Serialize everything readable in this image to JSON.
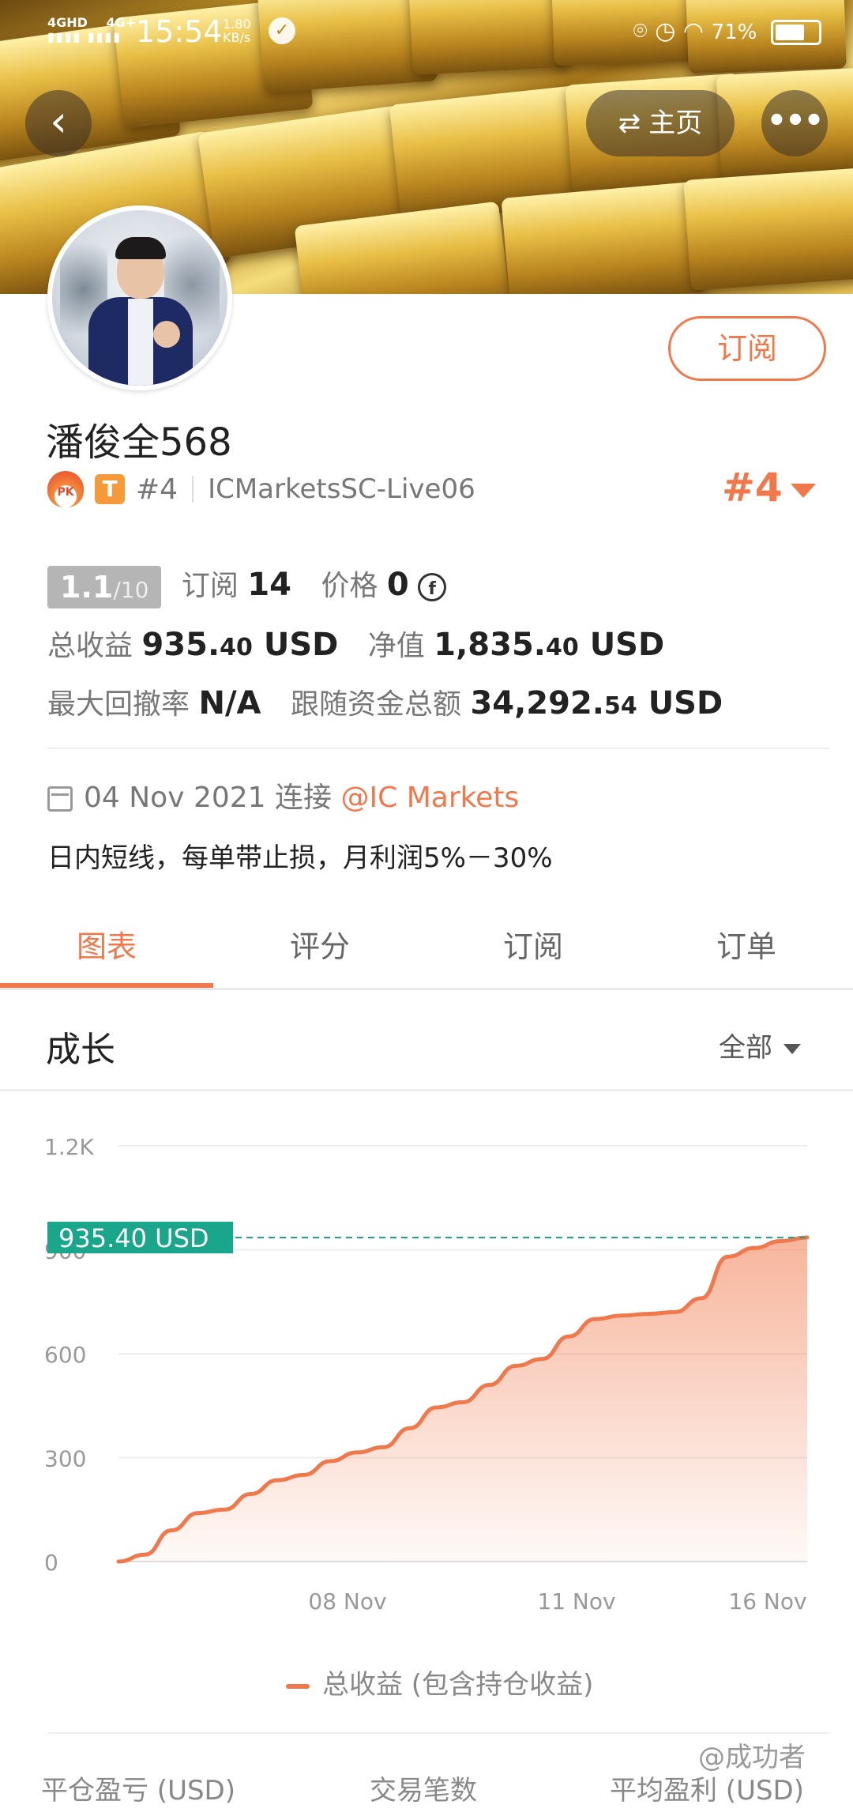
{
  "status_bar": {
    "network_1": "4GHD",
    "network_2": "4G+",
    "time": "15:54",
    "speed_value": "1.80",
    "speed_unit": "KB/s",
    "battery_text": "71%"
  },
  "header": {
    "home_label": "主页"
  },
  "profile": {
    "subscribe_label": "订阅",
    "name": "潘俊全568",
    "pk_badge": "PK",
    "t_badge": "T",
    "rank_small": "#4",
    "server": "ICMarketsSC-Live06",
    "rank_big": "#4"
  },
  "stats": {
    "score": "1.1",
    "score_den": "/10",
    "subscribe_label": "订阅",
    "subscribe_count": "14",
    "price_label": "价格",
    "price_value": "0",
    "total_profit_label": "总收益",
    "total_profit_int": "935.",
    "total_profit_dec": "40",
    "total_profit_unit": "USD",
    "equity_label": "净值",
    "equity_int": "1,835.",
    "equity_dec": "40",
    "equity_unit": "USD",
    "drawdown_label": "最大回撤率",
    "drawdown_value": "N/A",
    "follow_funds_label": "跟随资金总额",
    "follow_funds_int": "34,292.",
    "follow_funds_dec": "54",
    "follow_funds_unit": "USD"
  },
  "info": {
    "joined_date": "04 Nov 2021",
    "joined_label": "连接",
    "broker": "@IC Markets",
    "bio": "日内短线，每单带止损，月利润5%－30%"
  },
  "tabs": [
    {
      "label": "图表",
      "active": true
    },
    {
      "label": "评分",
      "active": false
    },
    {
      "label": "订阅",
      "active": false
    },
    {
      "label": "订单",
      "active": false
    }
  ],
  "section": {
    "title": "成长",
    "range": "全部"
  },
  "chart_data": {
    "type": "area",
    "x_tick_labels": [
      "08 Nov",
      "11 Nov",
      "16 Nov"
    ],
    "y_tick_labels": [
      "1.2K",
      "900",
      "600",
      "300",
      "0"
    ],
    "ylim": [
      0,
      1200
    ],
    "current_value_label": "935.40 USD",
    "current_value": 935.4,
    "series": [
      {
        "name": "总收益 (包含持仓收益)",
        "color": "#f0784a",
        "values": [
          0,
          20,
          90,
          140,
          150,
          195,
          235,
          250,
          290,
          315,
          330,
          385,
          445,
          460,
          510,
          565,
          585,
          650,
          700,
          710,
          715,
          720,
          760,
          880,
          905,
          925,
          935.4
        ]
      }
    ],
    "grid": true
  },
  "legend": {
    "label": "总收益 (包含持仓收益)"
  },
  "bottom_stats": {
    "col1": "平仓盈亏 (USD)",
    "col2": "交易笔数",
    "col3": "平均盈利 (USD)"
  },
  "watermark": "@成功者"
}
